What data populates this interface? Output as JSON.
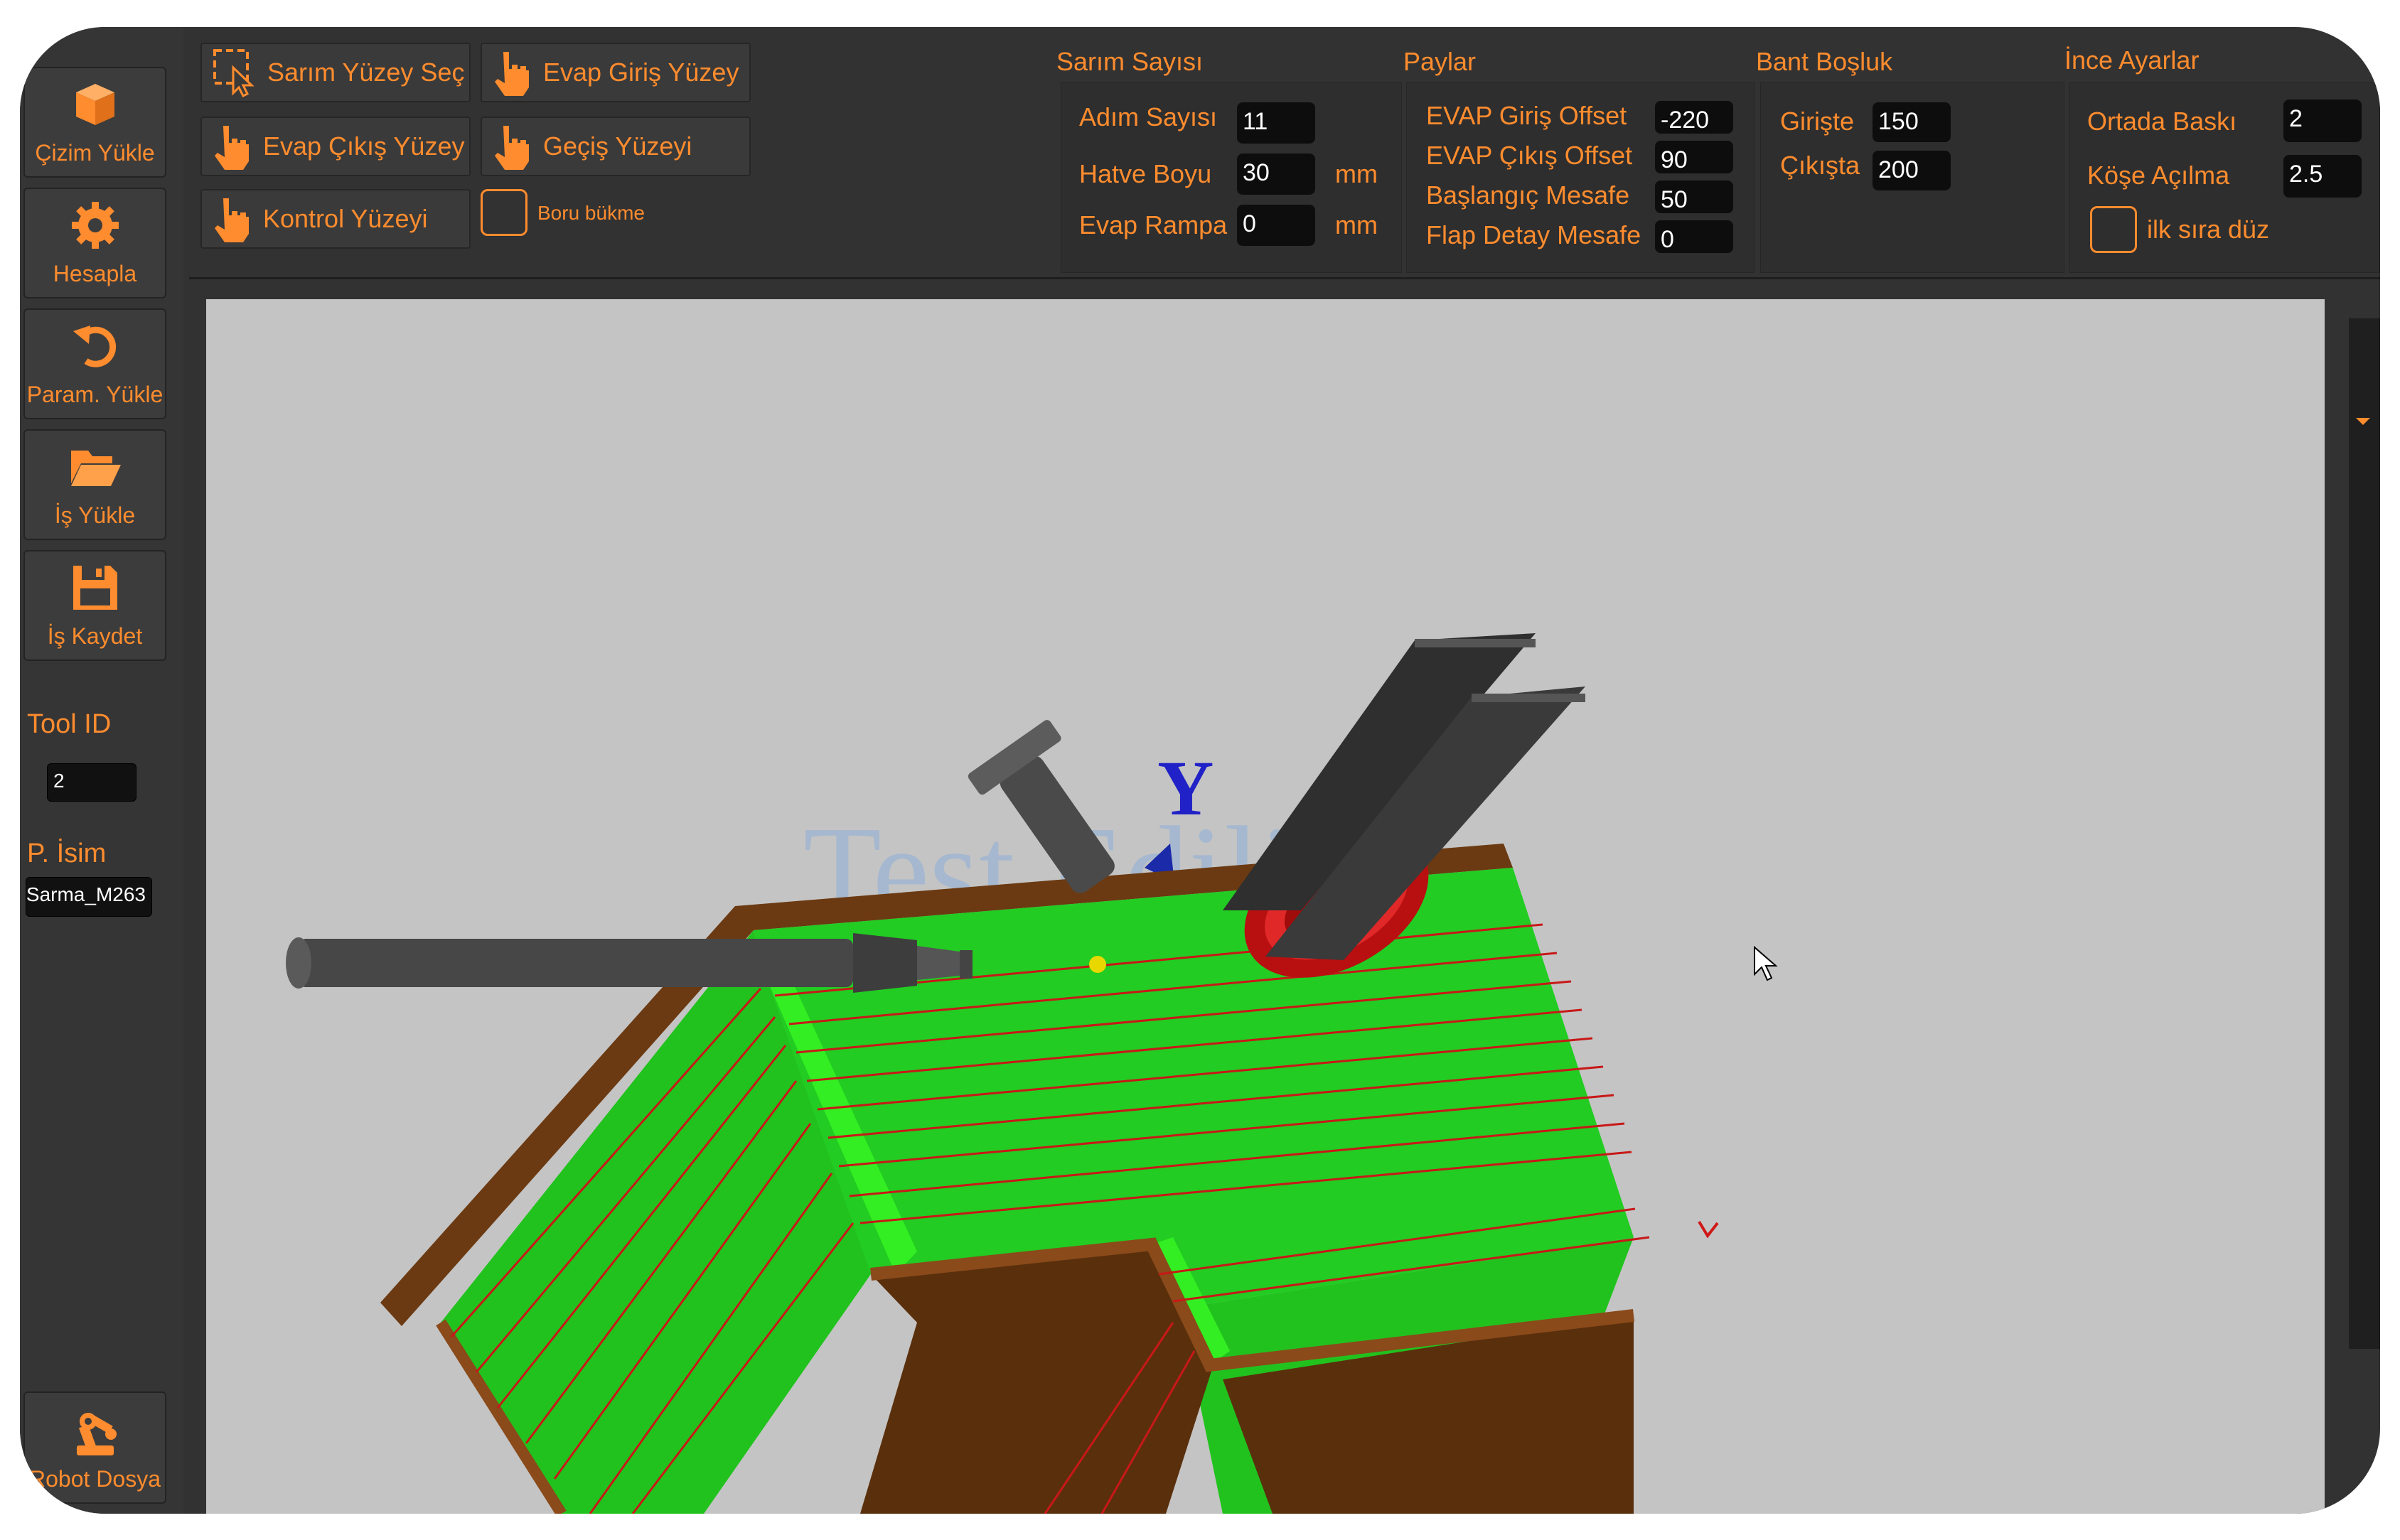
{
  "sidebar": {
    "buttons": [
      {
        "label": "Çizim Yükle",
        "icon": "box-icon"
      },
      {
        "label": "Hesapla",
        "icon": "gear-icon"
      },
      {
        "label": "Param. Yükle",
        "icon": "undo-icon"
      },
      {
        "label": "İş Yükle",
        "icon": "folder-open-icon"
      },
      {
        "label": "İş Kaydet",
        "icon": "save-icon"
      }
    ],
    "tool_id": {
      "label": "Tool ID",
      "value": "2"
    },
    "p_isim": {
      "label": "P. İsim",
      "value": "Sarma_M263"
    },
    "robot": {
      "label": "Robot Dosya",
      "icon": "robot-arm-icon"
    }
  },
  "toolbar": {
    "buttons": [
      {
        "label": "Sarım Yüzey Seç",
        "icon": "select-region-icon"
      },
      {
        "label": "Evap Giriş Yüzey",
        "icon": "hand-pointer-icon"
      },
      {
        "label": "Evap Çıkış Yüzey",
        "icon": "hand-pointer-icon"
      },
      {
        "label": "Geçiş Yüzeyi",
        "icon": "hand-pointer-icon"
      },
      {
        "label": "Kontrol Yüzeyi",
        "icon": "hand-pointer-icon"
      }
    ],
    "boru_bukme": {
      "label": "Boru bükme",
      "checked": false
    }
  },
  "groups": {
    "sarim": {
      "title": "Sarım Sayısı",
      "fields": [
        {
          "label": "Adım Sayısı",
          "value": "11",
          "unit": ""
        },
        {
          "label": "Hatve Boyu",
          "value": "30",
          "unit": "mm"
        },
        {
          "label": "Evap Rampa",
          "value": "0",
          "unit": "mm"
        }
      ]
    },
    "paylar": {
      "title": "Paylar",
      "fields": [
        {
          "label": "EVAP Giriş Offset",
          "value": "-220"
        },
        {
          "label": "EVAP Çıkış Offset",
          "value": "90"
        },
        {
          "label": "Başlangıç Mesafe",
          "value": "50"
        },
        {
          "label": "Flap Detay Mesafe",
          "value": "0"
        }
      ]
    },
    "bant": {
      "title": "Bant Boşluk",
      "fields": [
        {
          "label": "Girişte",
          "value": "150"
        },
        {
          "label": "Çıkışta",
          "value": "200"
        }
      ]
    },
    "ince": {
      "title": "İnce Ayarlar",
      "fields": [
        {
          "label": "Ortada Baskı",
          "value": "2"
        },
        {
          "label": "Köşe Açılma",
          "value": "2.5"
        }
      ],
      "ilk_sira": {
        "label": "ilk sıra düz",
        "checked": false
      }
    }
  },
  "viewport": {
    "axis_label": "Y",
    "watermark": "Test Edilir",
    "colors": {
      "background": "#c4c4c4",
      "surface": "#22cc22",
      "frame": "#6b3a12",
      "wire": "#d11a1a",
      "tool": "#4a4a4a"
    }
  },
  "colors": {
    "accent": "#ff8c2e",
    "panel": "#323232",
    "field": "#0d0d0d"
  }
}
